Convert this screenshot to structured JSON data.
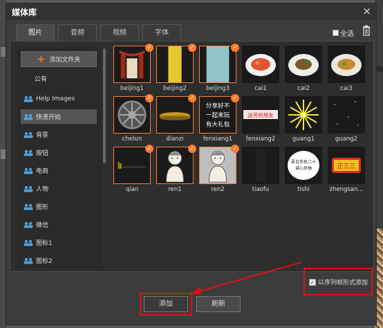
{
  "window": {
    "title": "媒体库",
    "close_glyph": "×"
  },
  "tabs": [
    {
      "label": "图片",
      "active": true
    },
    {
      "label": "音频",
      "active": false
    },
    {
      "label": "视频",
      "active": false
    },
    {
      "label": "字体",
      "active": false
    }
  ],
  "toolbar": {
    "select_all_label": "全选",
    "trash_icon": "trash-icon"
  },
  "sidebar": {
    "add_folder_label": "添加文件夹",
    "section_label": "公有",
    "folders": [
      {
        "label": "Help Images",
        "selected": false
      },
      {
        "label": "快速开始",
        "selected": true
      },
      {
        "label": "背景",
        "selected": false
      },
      {
        "label": "按钮",
        "selected": false
      },
      {
        "label": "电商",
        "selected": false
      },
      {
        "label": "人物",
        "selected": false
      },
      {
        "label": "图形",
        "selected": false
      },
      {
        "label": "微信",
        "selected": false
      },
      {
        "label": "图标1",
        "selected": false
      },
      {
        "label": "图标2",
        "selected": false
      }
    ]
  },
  "images": [
    {
      "name": "beijing1",
      "checked": true
    },
    {
      "name": "beijing2",
      "checked": true
    },
    {
      "name": "beijing3",
      "checked": true
    },
    {
      "name": "cai1",
      "checked": false
    },
    {
      "name": "cai2",
      "checked": false
    },
    {
      "name": "cai3",
      "checked": false
    },
    {
      "name": "chelun",
      "checked": true
    },
    {
      "name": "dianzi",
      "checked": true
    },
    {
      "name": "fenxiang1",
      "checked": true
    },
    {
      "name": "fenxiang2",
      "checked": false
    },
    {
      "name": "guang1",
      "checked": false
    },
    {
      "name": "guang2",
      "checked": false
    },
    {
      "name": "qian",
      "checked": true
    },
    {
      "name": "ren1",
      "checked": true
    },
    {
      "name": "ren2",
      "checked": true
    },
    {
      "name": "tiaofu",
      "checked": false
    },
    {
      "name": "tishi",
      "checked": false
    },
    {
      "name": "zhengsan...",
      "checked": false
    }
  ],
  "thumb_texts": {
    "fenxiang1": "分享好不\n一起来玩\n有大礼包",
    "fenxiang2": "送劳给朋友",
    "tishi": "夏日手机二十\n诚心来抽",
    "zhengsan": "正三三"
  },
  "footer": {
    "sequence_label": "以序列帧形式添加",
    "sequence_checked": true,
    "add_button": "添加",
    "refresh_button": "刷新"
  },
  "colors": {
    "accent": "#ff7b2e",
    "highlight_red": "#dd1111"
  }
}
